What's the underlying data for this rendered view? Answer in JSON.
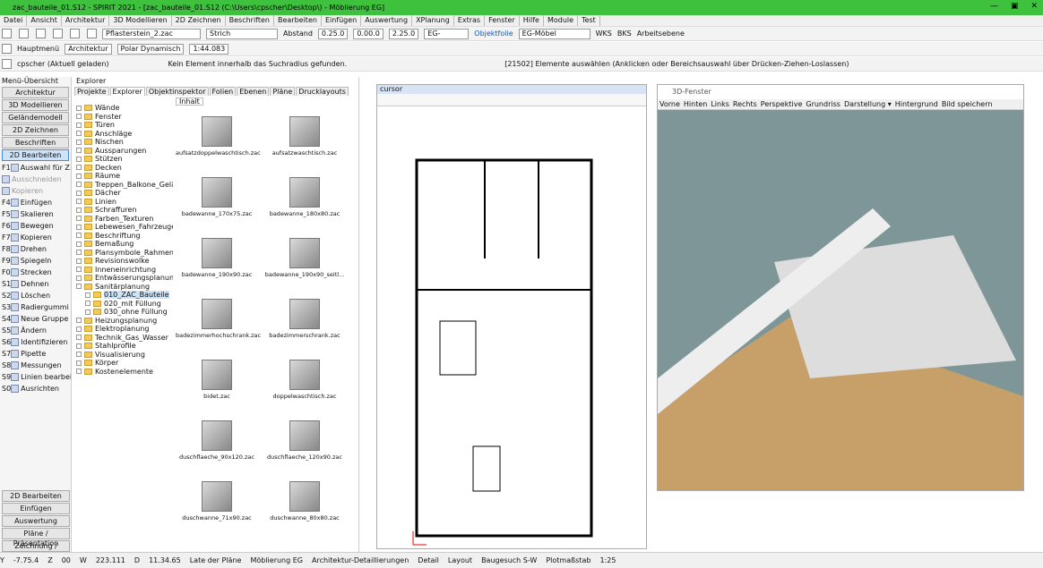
{
  "title": "zac_bauteile_01.S12 - SPIRIT 2021 - [zac_bauteile_01.S12 (C:\\Users\\cpscher\\Desktop\\) - Möblierung EG]",
  "menu": [
    "Datei",
    "Ansicht",
    "Architektur",
    "3D Modellieren",
    "2D Zeichnen",
    "Beschriften",
    "Bearbeiten",
    "Einfügen",
    "Auswertung",
    "XPlanung",
    "Extras",
    "Fenster",
    "Hilfe",
    "Module",
    "Test"
  ],
  "toolbar1": {
    "layer": "Pflasterstein_2.zac",
    "line": "Strich",
    "abstand_label": "Abstand",
    "abstand": "0.25.0",
    "v1": "0.00.0",
    "v2": "2.25.0",
    "eg": "EG-",
    "objektfolie": "Objektfolie",
    "moebel": "EG-Möbel",
    "wks": "WKS",
    "bks": "BKS",
    "arbeitsebene": "Arbeitsebene"
  },
  "toolbar2": {
    "hauptmenu": "Hauptmenü",
    "architektur": "Architektur",
    "polar": "Polar Dynamisch",
    "scale": "1:44.083"
  },
  "toolbar3": {
    "user": "cpscher (Aktuell geladen)",
    "message": "Kein Element innerhalb das Suchradius gefunden.",
    "hint": "[21502] Elemente auswählen (Anklicken oder Bereichsauswahl über Drücken-Ziehen-Loslassen)"
  },
  "left": {
    "header": "Menü-Übersicht",
    "buttons": [
      "Architektur",
      "3D Modellieren",
      "Geländemodell",
      "2D Zeichnen",
      "Beschriften",
      "2D Bearbeiten"
    ],
    "fkeys": [
      {
        "k": "F1",
        "t": "Auswahl für Z..."
      },
      {
        "k": "",
        "t": "Ausschneiden",
        "dis": true
      },
      {
        "k": "",
        "t": "Kopieren",
        "dis": true
      },
      {
        "k": "F4",
        "t": "Einfügen"
      },
      {
        "k": "F5",
        "t": "Skalieren"
      },
      {
        "k": "F6",
        "t": "Bewegen"
      },
      {
        "k": "F7",
        "t": "Kopieren"
      },
      {
        "k": "F8",
        "t": "Drehen"
      },
      {
        "k": "F9",
        "t": "Spiegeln"
      },
      {
        "k": "F0",
        "t": "Strecken"
      },
      {
        "k": "S1",
        "t": "Dehnen"
      },
      {
        "k": "S2",
        "t": "Löschen"
      },
      {
        "k": "S3",
        "t": "Radiergummi"
      },
      {
        "k": "S4",
        "t": "Neue Gruppe"
      },
      {
        "k": "S5",
        "t": "Ändern"
      },
      {
        "k": "S6",
        "t": "Identifizieren"
      },
      {
        "k": "S7",
        "t": "Pipette"
      },
      {
        "k": "S8",
        "t": "Messungen"
      },
      {
        "k": "S9",
        "t": "Linien bearbei..."
      },
      {
        "k": "S0",
        "t": "Ausrichten"
      }
    ],
    "bottom": [
      "2D Bearbeiten",
      "Einfügen",
      "Auswertung",
      "Pläne / Präsentation",
      "Zeichnung / System"
    ]
  },
  "explorer": {
    "header": "Explorer",
    "tabs": [
      "Projekte",
      "Explorer",
      "Objektinspektor",
      "Folien",
      "Ebenen",
      "Pläne",
      "Drucklayouts"
    ],
    "content_tab": "Inhalt",
    "tree": [
      "Wände",
      "Fenster",
      "Türen",
      "Anschläge",
      "Nischen",
      "Aussparungen",
      "Stützen",
      "Decken",
      "Räume",
      "Treppen_Balkone_Geländer",
      "Dächer",
      "Linien",
      "Schraffuren",
      "Farben_Texturen",
      "Lebewesen_Fahrzeuge_Veg",
      "Beschriftung",
      "Bemaßung",
      "Plansymbole_Rahmen",
      "Revisionswolke",
      "Inneneinrichtung",
      "Entwässerungsplanung",
      "Sanitärplanung",
      "010_ZAC_Bauteile",
      "020_mit Füllung",
      "030_ohne Füllung",
      "Heizungsplanung",
      "Elektroplanung",
      "Technik_Gas_Wasser",
      "Stahlprofile",
      "Visualisierung",
      "Körper",
      "Kostenelemente"
    ],
    "items": [
      "aufsatzdoppelwaschtisch.zac",
      "aufsatzwaschtisch.zac",
      "badewanne_170x75.zac",
      "badewanne_180x80.zac",
      "badewanne_190x90.zac",
      "badewanne_190x90_seitl...",
      "badezimmerhochschrank.zac",
      "badezimmerschrank.zac",
      "bidet.zac",
      "doppelwaschtisch.zac",
      "duschflaeche_90x120.zac",
      "duschflaeche_120x90.zac",
      "duschwanne_71x90.zac",
      "duschwanne_80x80.zac"
    ]
  },
  "cad": {
    "title": "cursor"
  },
  "view3d": {
    "title": "3D-Fenster",
    "menu": [
      "Vorne",
      "Hinten",
      "Links",
      "Rechts",
      "Perspektive",
      "Grundriss",
      "Darstellung ▾",
      "Hintergrund",
      "Bild speichern"
    ]
  },
  "status": {
    "a": "Y",
    "b": "-7.75.4",
    "c": "Z",
    "d": "00",
    "e": "W",
    "f": "223.111",
    "g": "D",
    "h": "11.34.65",
    "i": "Late der Pläne",
    "j": "Möblierung EG",
    "k": "Architektur-Detaillierungen",
    "l": "Detail",
    "m": "Layout",
    "n": "Baugesuch S-W",
    "o": "Plotmaßstab",
    "p": "1:25"
  }
}
